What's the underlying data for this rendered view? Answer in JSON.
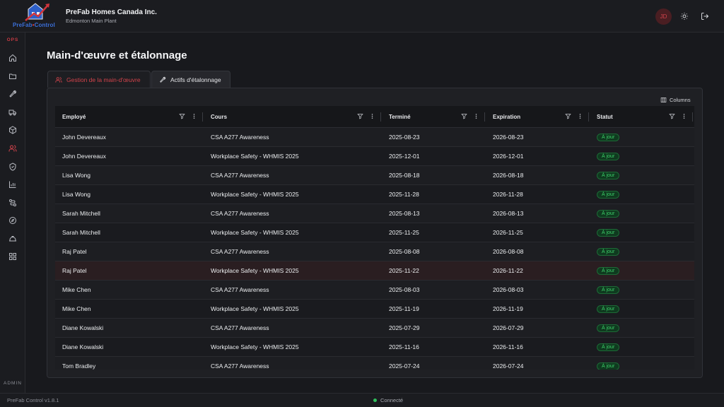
{
  "header": {
    "logo_text": "PreFab",
    "logo_text_accent": "Control",
    "company": "PreFab Homes Canada Inc.",
    "plant": "Edmonton Main Plant",
    "avatar_initials": "JD"
  },
  "sidebar": {
    "section_ops": "OPS",
    "section_admin": "ADMIN",
    "items": [
      {
        "icon": "home-icon"
      },
      {
        "icon": "folder-icon"
      },
      {
        "icon": "wrench-icon"
      },
      {
        "icon": "truck-icon"
      },
      {
        "icon": "box-icon"
      },
      {
        "icon": "users-icon",
        "active": true
      },
      {
        "icon": "shield-icon"
      },
      {
        "icon": "bar-chart-icon"
      },
      {
        "icon": "route-icon"
      },
      {
        "icon": "compass-icon"
      },
      {
        "icon": "hard-hat-icon"
      },
      {
        "icon": "grid-icon"
      }
    ]
  },
  "page": {
    "title": "Main-d'œuvre et étalonnage",
    "tabs": [
      {
        "label": "Gestion de la main-d'œuvre",
        "active": true
      },
      {
        "label": "Actifs d'étalonnage",
        "active": false
      }
    ],
    "columns_button": "Columns"
  },
  "table": {
    "headers": [
      "Employé",
      "Cours",
      "Terminé",
      "Expiration",
      "Statut"
    ],
    "rows": [
      {
        "employee": "John Devereaux",
        "course": "CSA A277 Awareness",
        "completed": "2025-08-23",
        "expiration": "2026-08-23",
        "status": "À jour"
      },
      {
        "employee": "John Devereaux",
        "course": "Workplace Safety - WHMIS 2025",
        "completed": "2025-12-01",
        "expiration": "2026-12-01",
        "status": "À jour"
      },
      {
        "employee": "Lisa Wong",
        "course": "CSA A277 Awareness",
        "completed": "2025-08-18",
        "expiration": "2026-08-18",
        "status": "À jour"
      },
      {
        "employee": "Lisa Wong",
        "course": "Workplace Safety - WHMIS 2025",
        "completed": "2025-11-28",
        "expiration": "2026-11-28",
        "status": "À jour"
      },
      {
        "employee": "Sarah Mitchell",
        "course": "CSA A277 Awareness",
        "completed": "2025-08-13",
        "expiration": "2026-08-13",
        "status": "À jour"
      },
      {
        "employee": "Sarah Mitchell",
        "course": "Workplace Safety - WHMIS 2025",
        "completed": "2025-11-25",
        "expiration": "2026-11-25",
        "status": "À jour"
      },
      {
        "employee": "Raj Patel",
        "course": "CSA A277 Awareness",
        "completed": "2025-08-08",
        "expiration": "2026-08-08",
        "status": "À jour"
      },
      {
        "employee": "Raj Patel",
        "course": "Workplace Safety - WHMIS 2025",
        "completed": "2025-11-22",
        "expiration": "2026-11-22",
        "status": "À jour",
        "highlighted": true
      },
      {
        "employee": "Mike Chen",
        "course": "CSA A277 Awareness",
        "completed": "2025-08-03",
        "expiration": "2026-08-03",
        "status": "À jour"
      },
      {
        "employee": "Mike Chen",
        "course": "Workplace Safety - WHMIS 2025",
        "completed": "2025-11-19",
        "expiration": "2026-11-19",
        "status": "À jour"
      },
      {
        "employee": "Diane Kowalski",
        "course": "CSA A277 Awareness",
        "completed": "2025-07-29",
        "expiration": "2026-07-29",
        "status": "À jour"
      },
      {
        "employee": "Diane Kowalski",
        "course": "Workplace Safety - WHMIS 2025",
        "completed": "2025-11-16",
        "expiration": "2026-11-16",
        "status": "À jour"
      },
      {
        "employee": "Tom Bradley",
        "course": "CSA A277 Awareness",
        "completed": "2025-07-24",
        "expiration": "2026-07-24",
        "status": "À jour"
      }
    ]
  },
  "footer": {
    "version": "PreFab Control v1.8.1",
    "connection": "Connecté"
  },
  "colors": {
    "accent": "#d2434b",
    "status_ok": "#3ecf6a",
    "background": "#18191d"
  }
}
